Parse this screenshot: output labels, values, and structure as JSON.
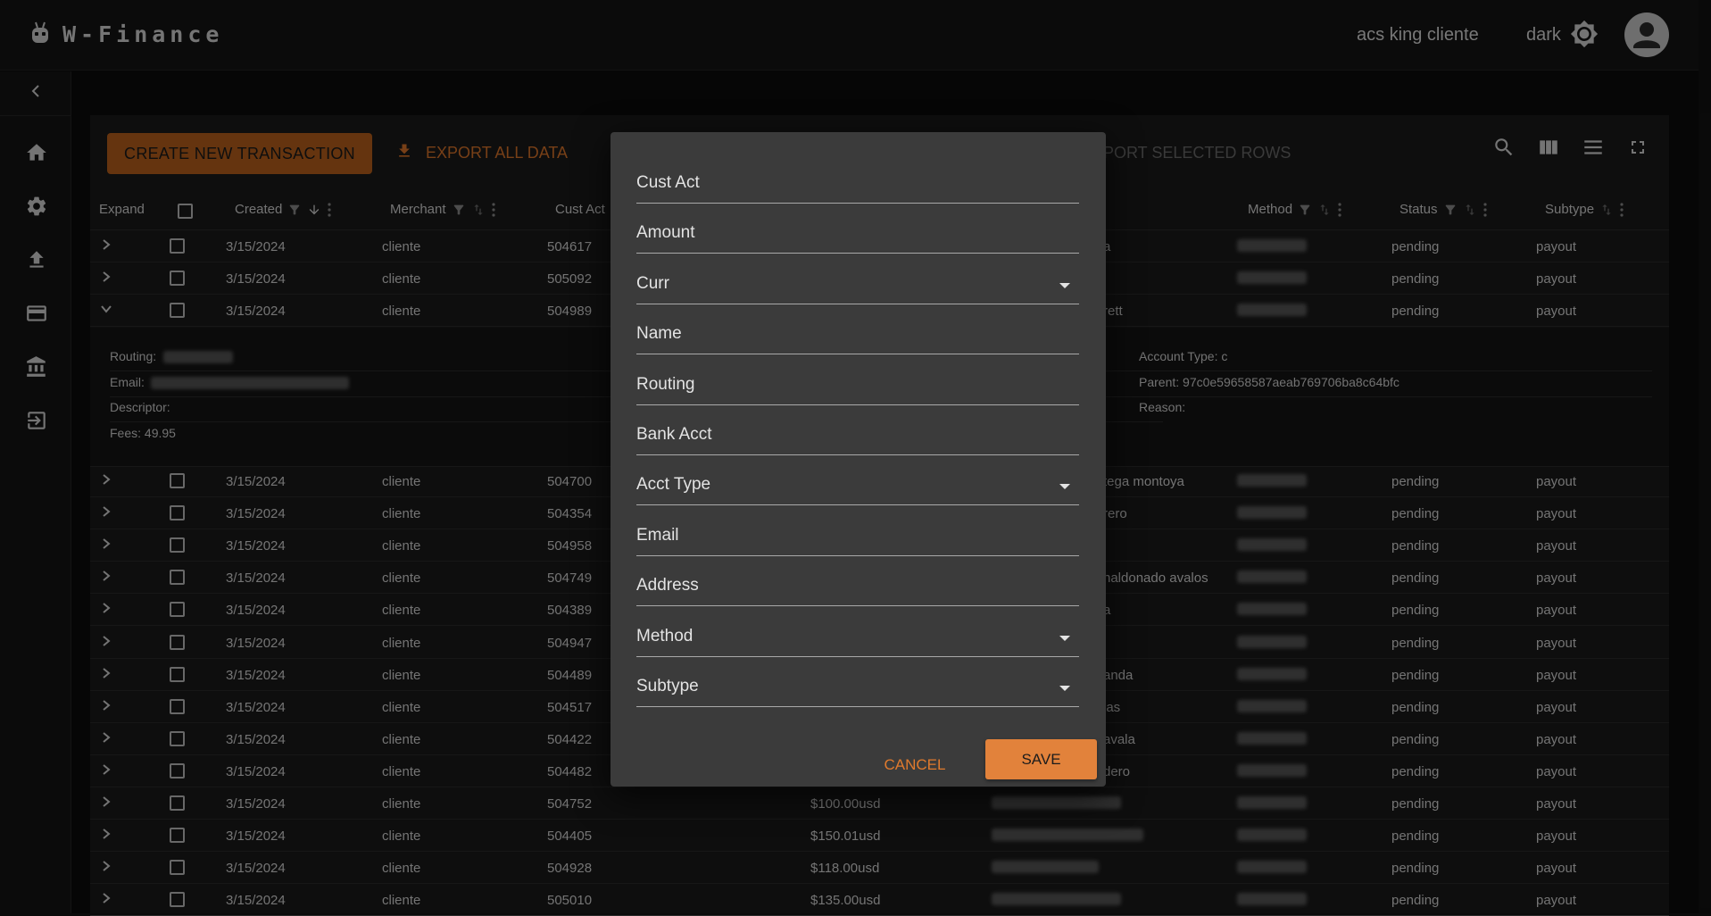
{
  "app": {
    "title": "W-Finance",
    "user_name": "acs king cliente",
    "theme_label": "dark"
  },
  "toolbar": {
    "create_label": "CREATE NEW TRANSACTION",
    "export_all_label": "EXPORT ALL DATA",
    "export_selected_label": "PORT SELECTED ROWS"
  },
  "columns": {
    "expand": "Expand",
    "created": "Created",
    "merchant": "Merchant",
    "cust_act": "Cust Act",
    "method": "Method",
    "status": "Status",
    "subtype": "Subtype"
  },
  "rows_top": [
    {
      "created": "3/15/2024",
      "merchant": "cliente",
      "cust_act": "504617",
      "name_tail": "a",
      "status": "pending",
      "subtype": "payout"
    },
    {
      "created": "3/15/2024",
      "merchant": "cliente",
      "cust_act": "505092",
      "name_tail": "",
      "status": "pending",
      "subtype": "payout"
    },
    {
      "created": "3/15/2024",
      "merchant": "cliente",
      "cust_act": "504989",
      "name_tail": "rett",
      "status": "pending",
      "subtype": "payout"
    }
  ],
  "detail": {
    "routing_label": "Routing:",
    "email_label": "Email:",
    "descriptor_label": "Descriptor:",
    "fees": "Fees: 49.95",
    "account_type": "Account Type: c",
    "parent": "Parent: 97c0e59658587aeab769706ba8c64bfc",
    "reason": "Reason:"
  },
  "rows": [
    {
      "created": "3/15/2024",
      "merchant": "cliente",
      "cust_act": "504700",
      "amount": "",
      "name_tail": "tega montoya",
      "status": "pending",
      "subtype": "payout"
    },
    {
      "created": "3/15/2024",
      "merchant": "cliente",
      "cust_act": "504354",
      "amount": "",
      "name_tail": "rero",
      "status": "pending",
      "subtype": "payout"
    },
    {
      "created": "3/15/2024",
      "merchant": "cliente",
      "cust_act": "504958",
      "amount": "",
      "name_tail": "",
      "status": "pending",
      "subtype": "payout"
    },
    {
      "created": "3/15/2024",
      "merchant": "cliente",
      "cust_act": "504749",
      "amount": "",
      "name_tail": "naldonado avalos",
      "status": "pending",
      "subtype": "payout"
    },
    {
      "created": "3/15/2024",
      "merchant": "cliente",
      "cust_act": "504389",
      "amount": "",
      "name_tail": "a",
      "status": "pending",
      "subtype": "payout"
    },
    {
      "created": "3/15/2024",
      "merchant": "cliente",
      "cust_act": "504947",
      "amount": "",
      "name_tail": "",
      "status": "pending",
      "subtype": "payout"
    },
    {
      "created": "3/15/2024",
      "merchant": "cliente",
      "cust_act": "504489",
      "amount": "",
      "name_tail": "anda",
      "status": "pending",
      "subtype": "payout"
    },
    {
      "created": "3/15/2024",
      "merchant": "cliente",
      "cust_act": "504517",
      "amount": "",
      "name_tail": "jas",
      "status": "pending",
      "subtype": "payout"
    },
    {
      "created": "3/15/2024",
      "merchant": "cliente",
      "cust_act": "504422",
      "amount": "",
      "name_tail": "avala",
      "status": "pending",
      "subtype": "payout"
    },
    {
      "created": "3/15/2024",
      "merchant": "cliente",
      "cust_act": "504482",
      "amount": "",
      "name_tail": "dero",
      "status": "pending",
      "subtype": "payout"
    },
    {
      "created": "3/15/2024",
      "merchant": "cliente",
      "cust_act": "504752",
      "amount": "$100.00usd",
      "name_tail": "",
      "status": "pending",
      "subtype": "payout"
    },
    {
      "created": "3/15/2024",
      "merchant": "cliente",
      "cust_act": "504405",
      "amount": "$150.01usd",
      "name_tail": "",
      "status": "pending",
      "subtype": "payout"
    },
    {
      "created": "3/15/2024",
      "merchant": "cliente",
      "cust_act": "504928",
      "amount": "$118.00usd",
      "name_tail": "",
      "status": "pending",
      "subtype": "payout"
    },
    {
      "created": "3/15/2024",
      "merchant": "cliente",
      "cust_act": "505010",
      "amount": "$135.00usd",
      "name_tail": "",
      "status": "pending",
      "subtype": "payout"
    }
  ],
  "dialog": {
    "fields": [
      {
        "label": "Cust Act",
        "select": false
      },
      {
        "label": "Amount",
        "select": false
      },
      {
        "label": "Curr",
        "select": true
      },
      {
        "label": "Name",
        "select": false
      },
      {
        "label": "Routing",
        "select": false
      },
      {
        "label": "Bank Acct",
        "select": false
      },
      {
        "label": "Acct Type",
        "select": true
      },
      {
        "label": "Email",
        "select": false
      },
      {
        "label": "Address",
        "select": false
      },
      {
        "label": "Method",
        "select": true
      },
      {
        "label": "Subtype",
        "select": true
      }
    ],
    "cancel_label": "CANCEL",
    "save_label": "SAVE"
  },
  "colors": {
    "accent": "#e2823b",
    "primary_button": "#b8601c",
    "background": "#0b0b0b",
    "dialog": "#3b3b3b"
  },
  "icons": [
    "robot-logo-icon",
    "brightness-icon",
    "account-circle-icon",
    "chevron-left-icon",
    "home-icon",
    "gear-icon",
    "upload-icon",
    "credit-card-icon",
    "bank-icon",
    "logout-icon",
    "download-icon",
    "search-icon",
    "columns-icon",
    "density-icon",
    "fullscreen-icon",
    "filter-icon",
    "sort-icon",
    "kebab-icon",
    "chevron-right-icon",
    "chevron-down-icon",
    "checkbox-icon",
    "caret-down-icon"
  ]
}
